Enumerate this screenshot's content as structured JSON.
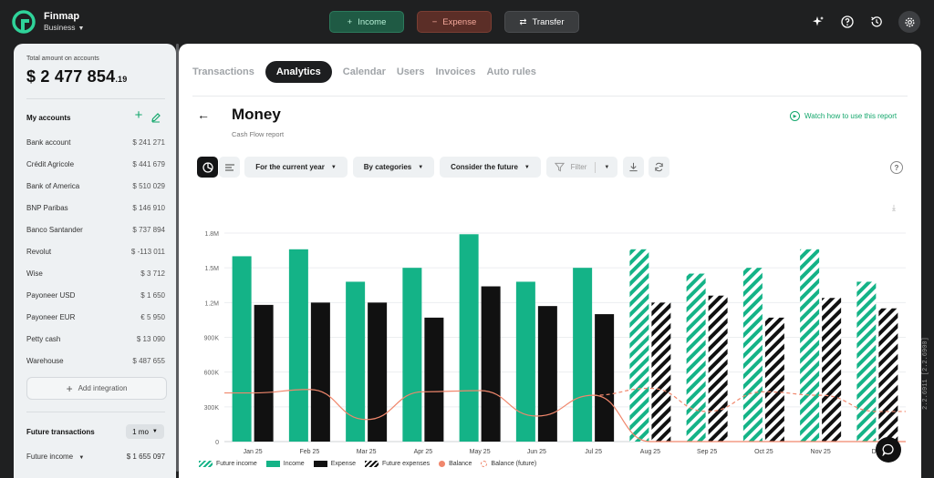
{
  "app": {
    "name": "Finmap",
    "workspace": "Business"
  },
  "colors": {
    "income": "#14b387",
    "expense": "#111111",
    "balance": "#f0876c",
    "accent": "#14a76c"
  },
  "topbar": {
    "income_label": "Income",
    "expense_label": "Expense",
    "transfer_label": "Transfer",
    "icons": [
      "sparkle-icon",
      "help-icon",
      "history-icon",
      "gear-icon"
    ]
  },
  "sidebar": {
    "total_label": "Total amount on accounts",
    "total_currency": "$",
    "total_main": "2 477 854",
    "total_cents": ".19",
    "my_accounts_title": "My accounts",
    "accounts": [
      {
        "name": "Bank account",
        "value": "$ 241 271"
      },
      {
        "name": "Crédit Agricole",
        "value": "$ 441 679"
      },
      {
        "name": "Bank of America",
        "value": "$ 510 029"
      },
      {
        "name": "BNP Paribas",
        "value": "$ 146 910"
      },
      {
        "name": "Banco Santander",
        "value": "$ 737 894"
      },
      {
        "name": "Revolut",
        "value": "$ -113 011"
      },
      {
        "name": "Wise",
        "value": "$ 3 712"
      },
      {
        "name": "Payoneer USD",
        "value": "$ 1 650"
      },
      {
        "name": "Payoneer EUR",
        "value": "€ 5 950"
      },
      {
        "name": "Petty cash",
        "value": "$ 13 090"
      },
      {
        "name": "Warehouse",
        "value": "$ 487 655"
      }
    ],
    "add_integration": "Add integration",
    "future_title": "Future transactions",
    "future_period": "1 mo",
    "future_income_label": "Future income",
    "future_income_value": "$ 1 655 097"
  },
  "main": {
    "tabs": [
      "Transactions",
      "Analytics",
      "Calendar",
      "Users",
      "Invoices",
      "Auto rules"
    ],
    "active_tab": "Analytics",
    "title": "Money",
    "subtitle": "Cash Flow report",
    "watch_link": "Watch how to use this report",
    "filters": {
      "period": "For the current year",
      "grouping": "By categories",
      "future": "Consider the future",
      "filter": "Filter"
    }
  },
  "chart_data": {
    "type": "bar",
    "categories": [
      "Jan 25",
      "Feb 25",
      "Mar 25",
      "Apr 25",
      "May 25",
      "Jun 25",
      "Jul 25",
      "Aug 25",
      "Sep 25",
      "Oct 25",
      "Nov 25",
      "Dec 25"
    ],
    "x_tick_labels": [
      "Jan 25",
      "Feb 25",
      "Mar 25",
      "Apr 25",
      "May 25",
      "Jun 25",
      "Jul 25",
      "Aug 25",
      "Sep 25",
      "Oct 25",
      "Nov 25",
      "Dec"
    ],
    "ylim": [
      0,
      1800000
    ],
    "y_ticks": [
      "0",
      "300K",
      "600K",
      "900K",
      "1.2M",
      "1.5M",
      "1.8M"
    ],
    "y_tick_values": [
      0,
      300000,
      600000,
      900000,
      1200000,
      1500000,
      1800000
    ],
    "series": [
      {
        "name": "Income",
        "values": [
          1600000,
          1660000,
          1380000,
          1500000,
          1790000,
          1380000,
          1500000,
          null,
          null,
          null,
          null,
          null
        ]
      },
      {
        "name": "Expense",
        "values": [
          1180000,
          1200000,
          1200000,
          1070000,
          1340000,
          1170000,
          1100000,
          null,
          null,
          null,
          null,
          null
        ]
      },
      {
        "name": "Future income",
        "values": [
          null,
          null,
          null,
          null,
          null,
          null,
          null,
          1660000,
          1450000,
          1500000,
          1660000,
          1380000
        ]
      },
      {
        "name": "Future expenses",
        "values": [
          null,
          null,
          null,
          null,
          null,
          null,
          null,
          1200000,
          1260000,
          1070000,
          1240000,
          1150000
        ]
      },
      {
        "name": "Balance",
        "values": [
          420000,
          450000,
          190000,
          430000,
          440000,
          220000,
          400000,
          0,
          0,
          0,
          0,
          0
        ]
      },
      {
        "name": "Balance (future)",
        "values": [
          null,
          null,
          null,
          null,
          null,
          null,
          400000,
          460000,
          260000,
          430000,
          400000,
          260000
        ]
      }
    ],
    "legend": [
      "Future income",
      "Income",
      "Expense",
      "Future expenses",
      "Balance",
      "Balance (future)"
    ],
    "legend_position": "bottom",
    "grid": true
  },
  "version": "2.2.6911 [2.2.6900]"
}
